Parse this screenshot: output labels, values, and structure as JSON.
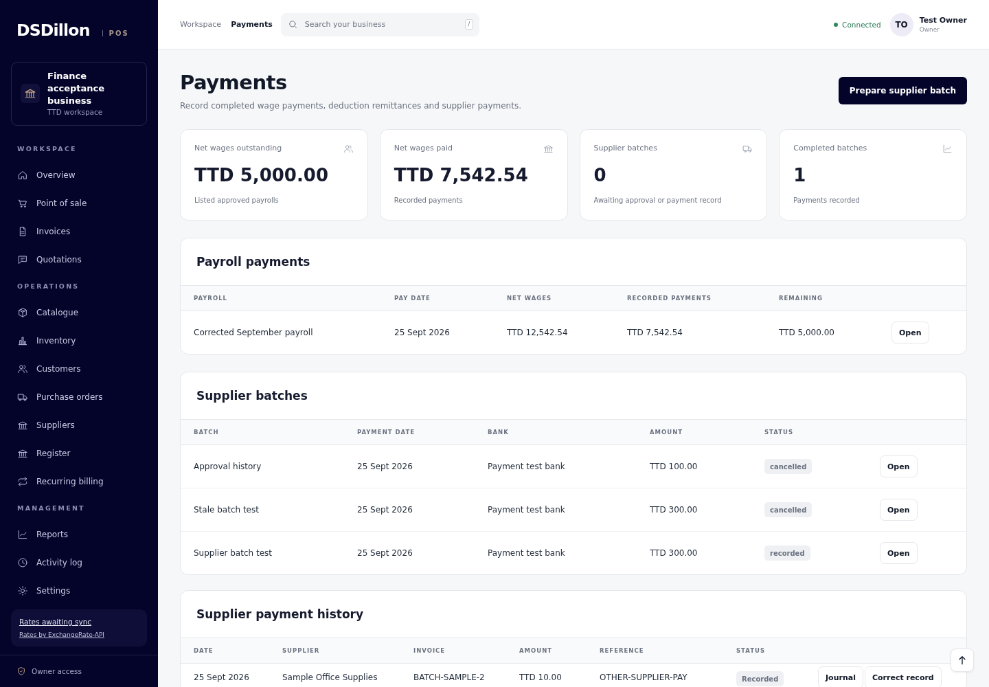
{
  "sidebar": {
    "logo": "DSDillon",
    "product": "POS",
    "workspace": {
      "name": "Finance acceptance business",
      "note": "TTD workspace"
    },
    "sections": [
      {
        "title": "WORKSPACE",
        "items": [
          {
            "label": "Overview",
            "selected": false
          },
          {
            "label": "Point of sale",
            "selected": false
          },
          {
            "label": "Invoices",
            "selected": false
          },
          {
            "label": "Quotations",
            "selected": false
          }
        ]
      },
      {
        "title": "OPERATIONS",
        "items": [
          {
            "label": "Catalogue",
            "selected": false
          },
          {
            "label": "Inventory",
            "selected": false
          },
          {
            "label": "Customers",
            "selected": false
          },
          {
            "label": "Purchase orders",
            "selected": false
          },
          {
            "label": "Suppliers",
            "selected": false
          },
          {
            "label": "Register",
            "selected": false
          },
          {
            "label": "Recurring billing",
            "selected": false
          }
        ]
      },
      {
        "title": "MANAGEMENT",
        "items": [
          {
            "label": "Reports",
            "selected": false
          },
          {
            "label": "Activity log",
            "selected": false
          },
          {
            "label": "Settings",
            "selected": false
          }
        ]
      }
    ],
    "rates": {
      "status": "Rates awaiting sync",
      "source": "Rates by ExchangeRate-API"
    },
    "access": "Owner access"
  },
  "topbar": {
    "breadcrumbs": [
      {
        "label": "Workspace",
        "selected": false
      },
      {
        "label": "Payments",
        "selected": true
      }
    ],
    "search": {
      "placeholder": "Search your business",
      "shortcut": "/"
    },
    "connection": {
      "label": "Connected",
      "connected": true
    },
    "user": {
      "initials": "TO",
      "name": "Test Owner",
      "role": "Owner"
    }
  },
  "page": {
    "title": "Payments",
    "subtitle": "Record completed wage payments, deduction remittances and supplier payments.",
    "action": "Prepare supplier batch"
  },
  "stats": [
    {
      "label": "Net wages outstanding",
      "value": "TTD 5,000.00",
      "note": "Listed approved payrolls"
    },
    {
      "label": "Net wages paid",
      "value": "TTD 7,542.54",
      "note": "Recorded payments"
    },
    {
      "label": "Supplier batches",
      "value": "0",
      "note": "Awaiting approval or payment record"
    },
    {
      "label": "Completed batches",
      "value": "1",
      "note": "Payments recorded"
    }
  ],
  "payroll": {
    "title": "Payroll payments",
    "columns": [
      "PAYROLL",
      "PAY DATE",
      "NET WAGES",
      "RECORDED PAYMENTS",
      "REMAINING"
    ],
    "rows": [
      {
        "cells": [
          "Corrected September payroll",
          "25 Sept 2026",
          "TTD 12,542.54",
          "TTD 7,542.54",
          "TTD 5,000.00"
        ],
        "action": "Open"
      }
    ]
  },
  "batches": {
    "title": "Supplier batches",
    "columns": [
      "BATCH",
      "PAYMENT DATE",
      "BANK",
      "AMOUNT",
      "STATUS"
    ],
    "rows": [
      {
        "cells": [
          "Approval history",
          "25 Sept 2026",
          "Payment test bank",
          "TTD 100.00"
        ],
        "status": "cancelled",
        "action": "Open"
      },
      {
        "cells": [
          "Stale batch test",
          "25 Sept 2026",
          "Payment test bank",
          "TTD 300.00"
        ],
        "status": "cancelled",
        "action": "Open"
      },
      {
        "cells": [
          "Supplier batch test",
          "25 Sept 2026",
          "Payment test bank",
          "TTD 300.00"
        ],
        "status": "recorded",
        "action": "Open"
      }
    ]
  },
  "history": {
    "title": "Supplier payment history",
    "columns": [
      "DATE",
      "SUPPLIER",
      "INVOICE",
      "AMOUNT",
      "REFERENCE",
      "STATUS"
    ],
    "rows": [
      {
        "cells": [
          "25 Sept 2026",
          "Sample Office Supplies",
          "BATCH-SAMPLE-2",
          "TTD 10.00",
          "OTHER-SUPPLIER-PAY"
        ],
        "status": "Recorded",
        "actions": [
          "Journal",
          "Correct record"
        ]
      }
    ]
  }
}
